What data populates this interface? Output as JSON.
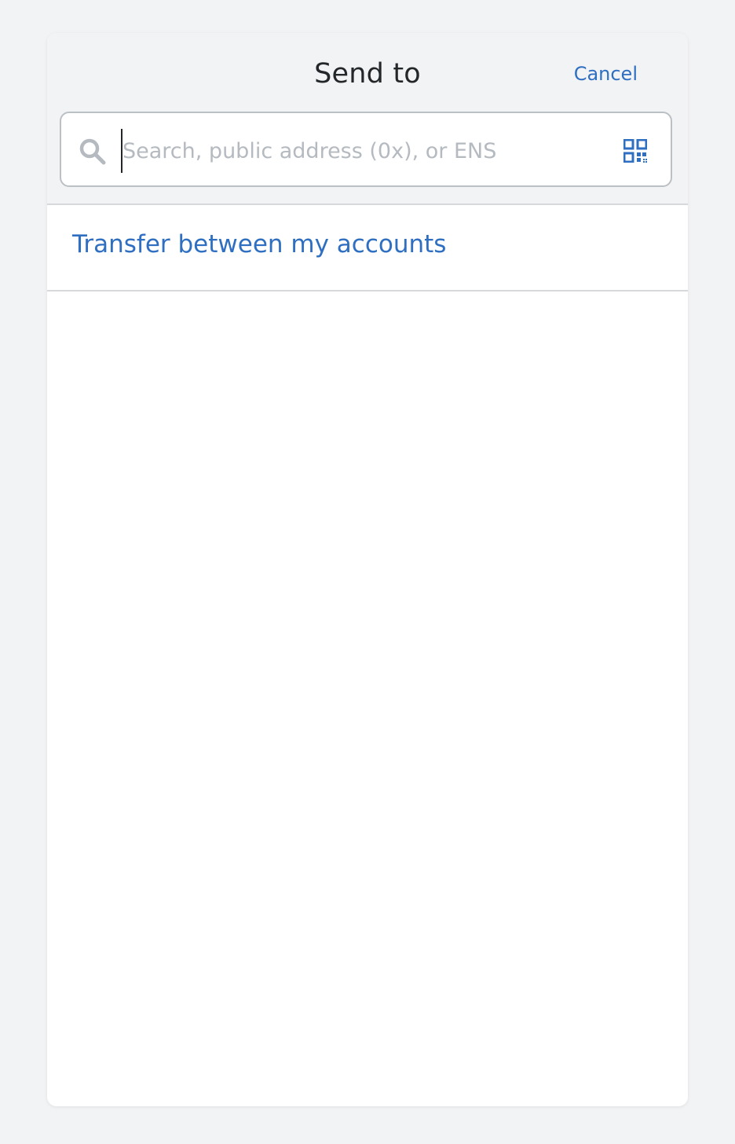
{
  "header": {
    "title": "Send to",
    "cancel_label": "Cancel"
  },
  "search": {
    "placeholder": "Search, public address (0x), or ENS",
    "value": "",
    "left_icon": "search-icon",
    "right_icon": "qr-code-icon"
  },
  "transfer": {
    "label": "Transfer between my accounts"
  },
  "colors": {
    "accent": "#2f6fc1",
    "background": "#f2f3f4",
    "divider": "#d6d9dc",
    "text": "#24272a",
    "placeholder": "#b5bac0"
  }
}
